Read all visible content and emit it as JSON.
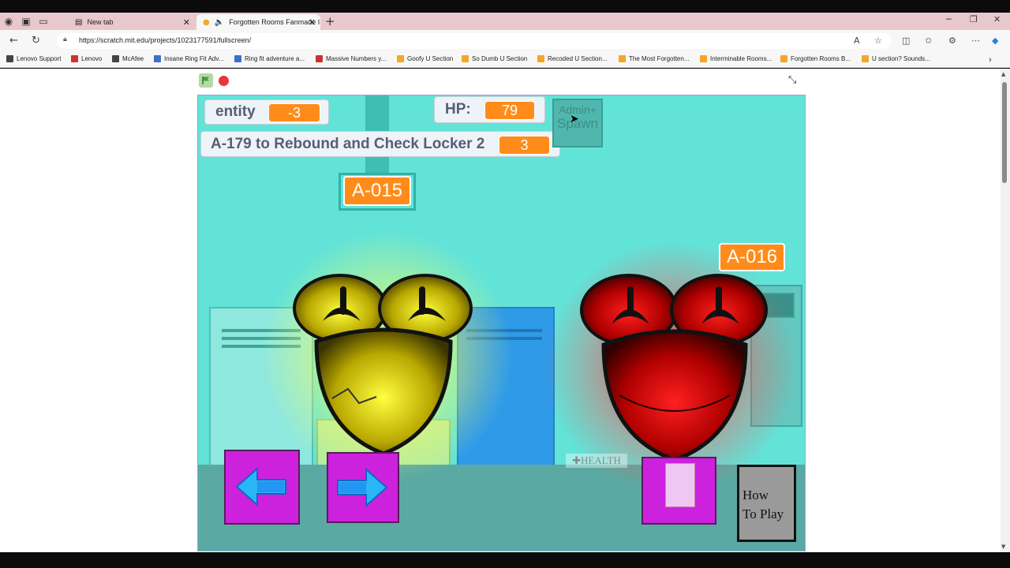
{
  "browser": {
    "tabs": [
      {
        "label": "New tab",
        "icon": "page-icon"
      },
      {
        "label": "Forgotten Rooms Fanmade I",
        "icon": "scratch-icon",
        "audio": true
      }
    ],
    "url": "https://scratch.mit.edu/projects/1023177591/fullscreen/",
    "bookmarks": [
      {
        "label": "Lenovo Support",
        "color": "#444444"
      },
      {
        "label": "Lenovo",
        "color": "#d32f2f"
      },
      {
        "label": "McAfee",
        "color": "#444444"
      },
      {
        "label": "Insane Ring Fit Adv...",
        "color": "#3f6ecc"
      },
      {
        "label": "Ring fit adventure a...",
        "color": "#3f6ecc"
      },
      {
        "label": "Massive Numbers y...",
        "color": "#d32f2f"
      },
      {
        "label": "Goofy U Section",
        "color": "#f5a623"
      },
      {
        "label": "So Dumb U Section",
        "color": "#f5a623"
      },
      {
        "label": "Recoded U Section...",
        "color": "#f5a623"
      },
      {
        "label": "The Most Forgotten...",
        "color": "#f5a623"
      },
      {
        "label": "Interminable Rooms...",
        "color": "#f5a623"
      },
      {
        "label": "Forgotten Rooms B...",
        "color": "#f5a623"
      },
      {
        "label": "U section? Sounds...",
        "color": "#f5a623"
      }
    ]
  },
  "game": {
    "vars": {
      "entity_label": "entity",
      "entity_value": "-3",
      "hp_label": "HP:",
      "hp_value": "79",
      "locker_label": "A-179 to Rebound and Check Locker 2",
      "locker_value": "3"
    },
    "door_left": "A-015",
    "door_right": "A-016",
    "admin_line1": "Admin+",
    "admin_line2": "Spawn",
    "health_sign": "✚HEALTH",
    "howto_line1": "How",
    "howto_line2": "To Play",
    "colors": {
      "stage_bg": "#62e3d8",
      "var_orange": "#ff8c1a",
      "button_magenta": "#cc22dd",
      "entity_yellow": "#e0d000",
      "entity_red": "#e02020"
    }
  }
}
